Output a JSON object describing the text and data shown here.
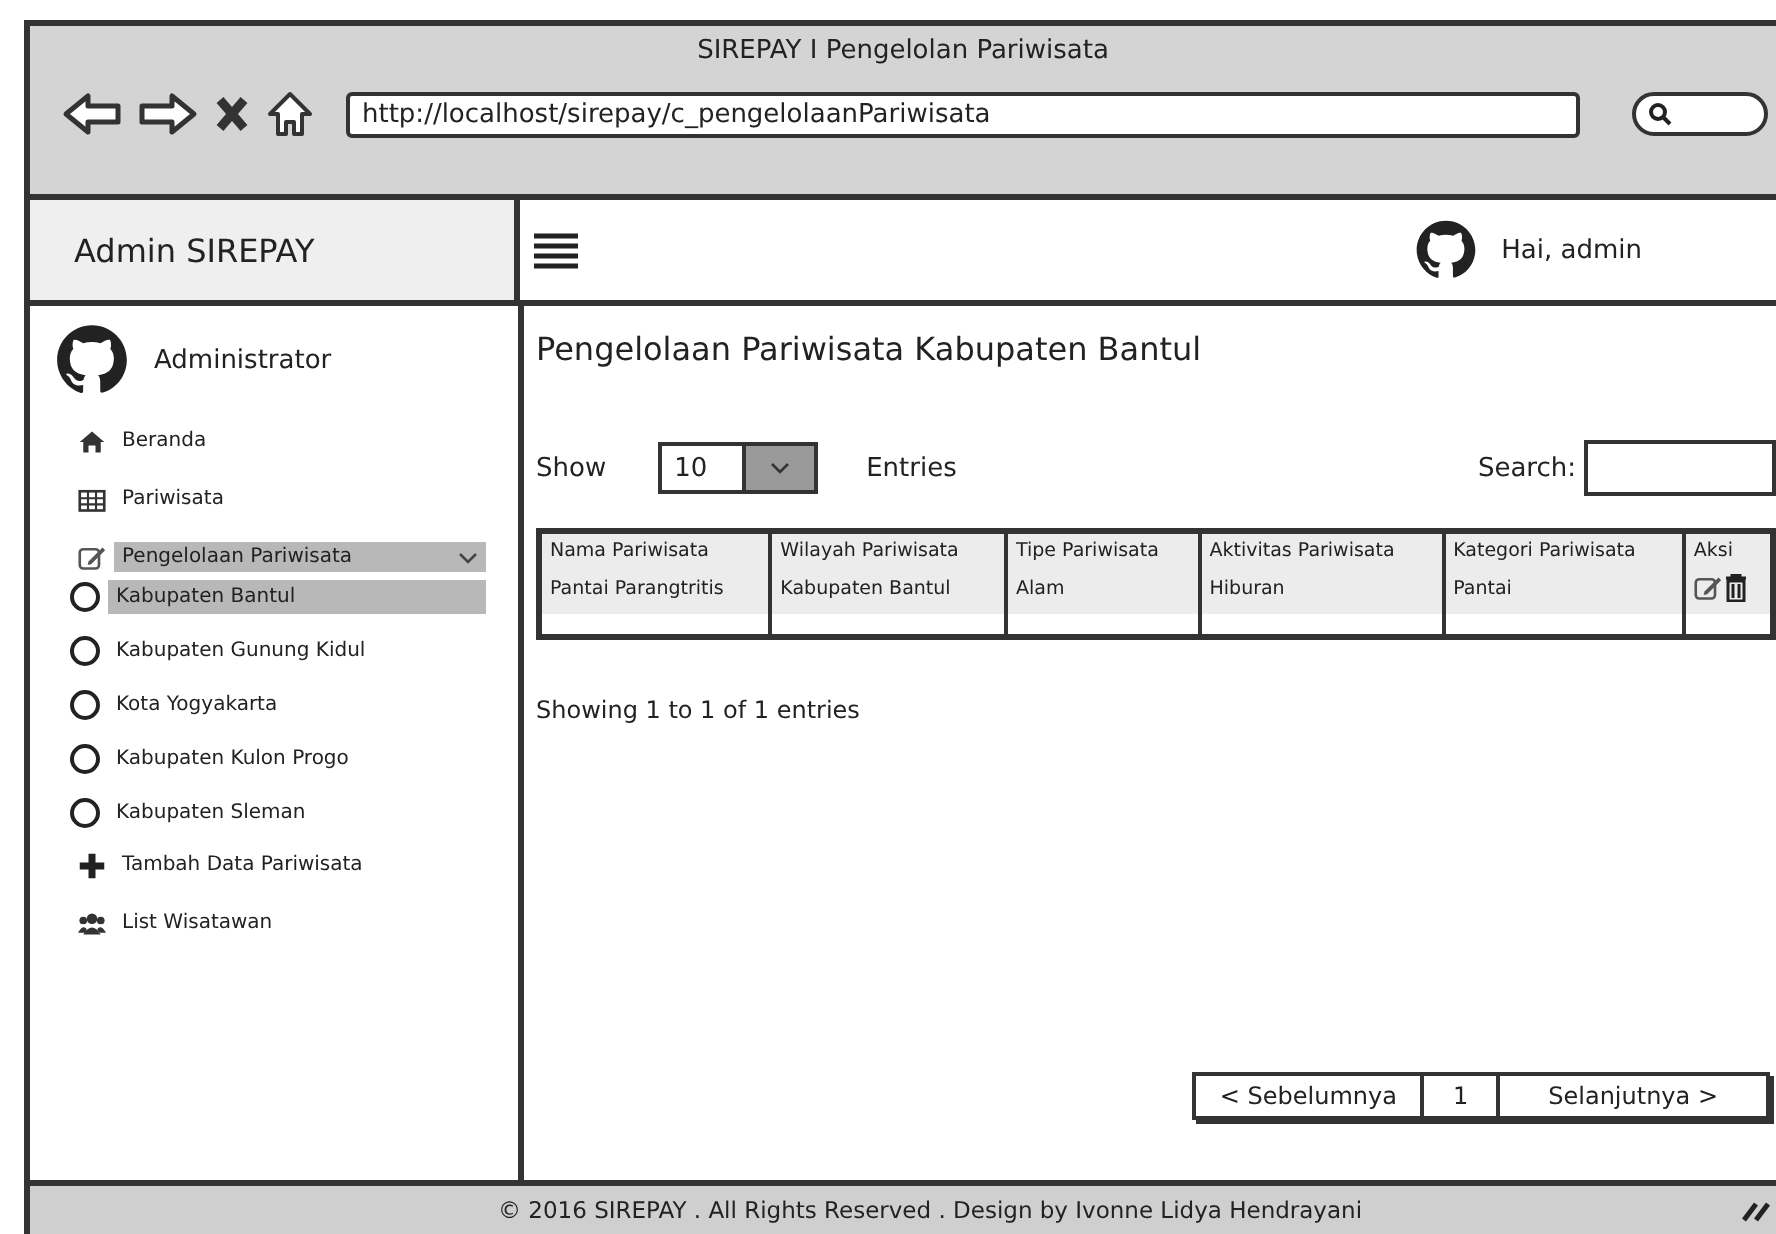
{
  "window": {
    "title": "SIREPAY I Pengelolan Pariwisata",
    "url": "http://localhost/sirepay/c_pengelolaanPariwisata"
  },
  "brand": "Admin SIREPAY",
  "user_greeting": "Hai, admin",
  "sidebar": {
    "user": "Administrator",
    "items": [
      {
        "label": "Beranda",
        "kind": "home",
        "selected": false
      },
      {
        "label": "Pariwisata",
        "kind": "table",
        "selected": false
      },
      {
        "label": "Pengelolaan Pariwisata",
        "kind": "edit",
        "selected": true,
        "expanded": true,
        "children": [
          {
            "label": "Kabupaten Bantul",
            "selected": true
          },
          {
            "label": "Kabupaten Gunung Kidul",
            "selected": false
          },
          {
            "label": "Kota Yogyakarta",
            "selected": false
          },
          {
            "label": "Kabupaten Kulon Progo",
            "selected": false
          },
          {
            "label": "Kabupaten Sleman",
            "selected": false
          }
        ]
      },
      {
        "label": "Tambah Data Pariwisata",
        "kind": "plus",
        "selected": false
      },
      {
        "label": "List Wisatawan",
        "kind": "users",
        "selected": false
      }
    ]
  },
  "page_title": "Pengelolaan Pariwisata Kabupaten Bantul",
  "controls": {
    "show_label": "Show",
    "page_size": "10",
    "entries_label": "Entries",
    "search_label": "Search:"
  },
  "table": {
    "columns": [
      "Nama Pariwisata",
      "Wilayah Pariwisata",
      "Tipe Pariwisata",
      "Aktivitas Pariwisata",
      "Kategori Pariwisata",
      "Aksi"
    ],
    "rows": [
      [
        "Pantai Parangtritis",
        "Kabupaten Bantul",
        "Alam",
        "Hiburan",
        "Pantai"
      ]
    ]
  },
  "summary": "Showing 1 to 1 of 1 entries",
  "pagination": {
    "previous": "< Sebelumnya",
    "page": "1",
    "next": "Selanjutnya >"
  },
  "footer": "© 2016 SIREPAY . All Rights Reserved . Design by Ivonne Lidya Hendrayani"
}
